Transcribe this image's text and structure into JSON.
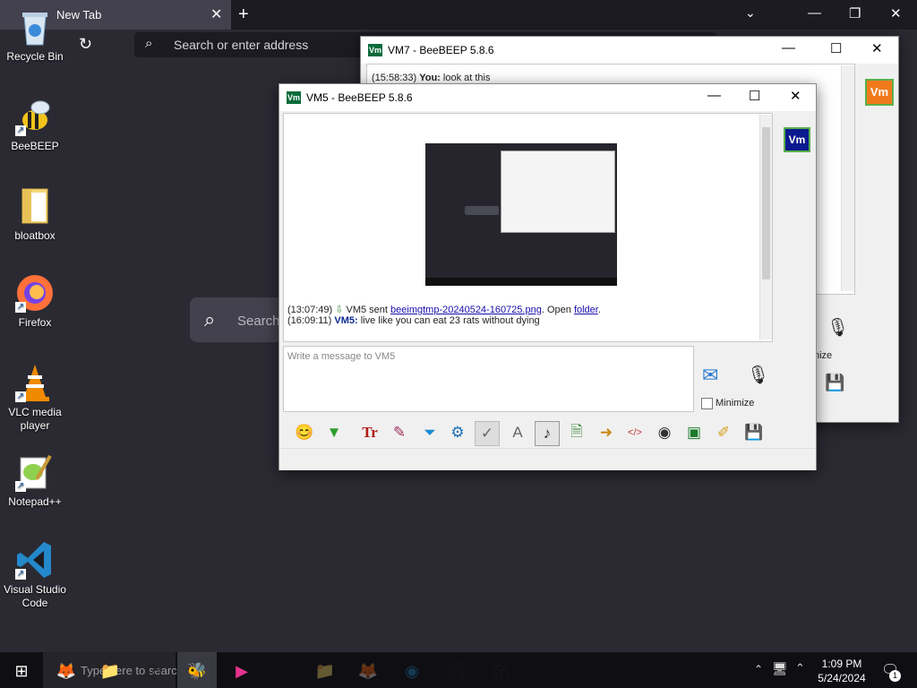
{
  "firefox": {
    "tab_title": "New Tab",
    "address_placeholder": "Search or enter address",
    "big_search_placeholder": "Search"
  },
  "desktop_icons": [
    {
      "label": "Recycle Bin"
    },
    {
      "label": "BeeBEEP"
    },
    {
      "label": "bloatbox"
    },
    {
      "label": "Firefox"
    },
    {
      "label": "VLC media player"
    },
    {
      "label": "Notepad++"
    },
    {
      "label": "Visual Studio Code"
    }
  ],
  "vm7": {
    "title": "VM7 - BeeBEEP 5.8.6",
    "line_ts": "(15:58:33)",
    "line_sender": "You:",
    "line_text": "look at this",
    "avatar": "Vm",
    "partial_label": "nize"
  },
  "vm5": {
    "title": "VM5 - BeeBEEP 5.8.6",
    "avatar": "Vm",
    "msg1_ts": "(13:07:49)",
    "msg1_pre": "VM5 sent",
    "msg1_link": "beeimgtmp-20240524-160725.png",
    "msg1_mid": ". Open",
    "msg1_folder": "folder",
    "msg1_end": ".",
    "msg2_ts": "(16:09:11)",
    "msg2_sender": "VM5:",
    "msg2_text": "live like you can eat 23 rats without dying",
    "input_placeholder": "Write a message to VM5",
    "minimize_label": "Minimize"
  },
  "tray": {
    "time": "1:09 PM",
    "date": "5/24/2024",
    "notifications": "1"
  },
  "taskbar_search_placeholder": "Type here to search"
}
